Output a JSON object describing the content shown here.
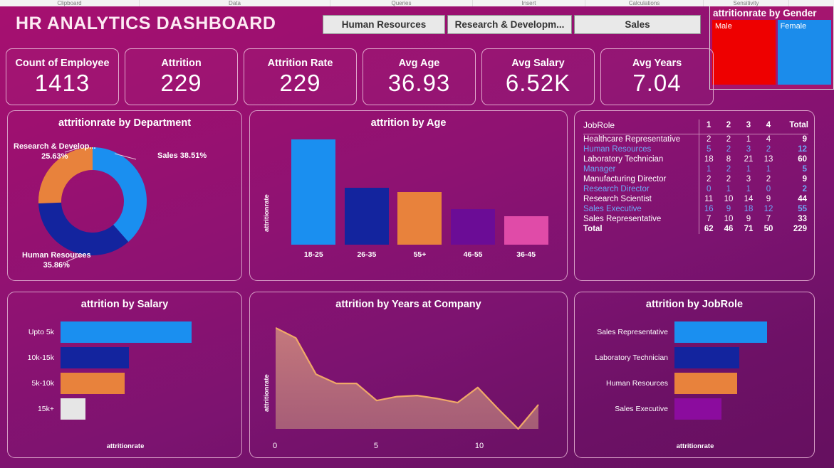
{
  "ribbon": {
    "groups": [
      "Clipboard",
      "Data",
      "Queries",
      "Insert",
      "Calculations",
      "Sensitivity"
    ]
  },
  "header": {
    "title": "HR ANALYTICS DASHBOARD",
    "slicers": [
      "Human Resources",
      "Research & Developm...",
      "Sales"
    ]
  },
  "gender_panel": {
    "title": "attritionrate by Gender",
    "cells": [
      {
        "label": "Male",
        "color": "#ee0000",
        "share": 54
      },
      {
        "label": "Female",
        "color": "#1b8ceb",
        "share": 46
      }
    ]
  },
  "kpis": [
    {
      "label": "Count of Employee",
      "value": "1413"
    },
    {
      "label": "Attrition",
      "value": "229"
    },
    {
      "label": "Attrition Rate",
      "value": "229"
    },
    {
      "label": "Avg Age",
      "value": "36.93"
    },
    {
      "label": "Avg Salary",
      "value": "6.52K"
    },
    {
      "label": "Avg Years",
      "value": "7.04"
    }
  ],
  "colors": {
    "blue": "#1a8ff0",
    "navy": "#13249e",
    "orange": "#e8823c",
    "purple": "#6b0c96",
    "pink": "#e04ba8",
    "white": "#e6e6e6",
    "accent_line": "#f0a868"
  },
  "chart_data": [
    {
      "id": "dept",
      "type": "pie",
      "title": "attritionrate by Department",
      "labels": [
        "Sales",
        "Human Resources",
        "Research & Develop..."
      ],
      "values": [
        38.51,
        35.86,
        25.63
      ],
      "value_labels": [
        "Sales 38.51%",
        "Human Resources",
        "Research & Develop..."
      ],
      "pct_labels": [
        "38.51%",
        "35.86%",
        "25.63%"
      ],
      "colors": [
        "#1a8ff0",
        "#13249e",
        "#e8823c"
      ]
    },
    {
      "id": "age",
      "type": "bar",
      "title": "attrition by Age",
      "categories": [
        "18-25",
        "26-35",
        "55+",
        "46-55",
        "36-45"
      ],
      "values": [
        100,
        54,
        50,
        34,
        27
      ],
      "colors": [
        "#1a8ff0",
        "#13249e",
        "#e8823c",
        "#6b0c96",
        "#e04ba8"
      ],
      "xlabel": "",
      "ylabel": "attritionrate"
    },
    {
      "id": "jobrole_matrix",
      "type": "table",
      "title": "JobRole",
      "columns": [
        "JobRole",
        "1",
        "2",
        "3",
        "4",
        "Total"
      ],
      "rows": [
        {
          "role": "Healthcare Representative",
          "cells": [
            "2",
            "2",
            "1",
            "4"
          ],
          "total": "9"
        },
        {
          "role": "Human Resources",
          "cells": [
            "5",
            "2",
            "3",
            "2"
          ],
          "total": "12"
        },
        {
          "role": "Laboratory Technician",
          "cells": [
            "18",
            "8",
            "21",
            "13"
          ],
          "total": "60"
        },
        {
          "role": "Manager",
          "cells": [
            "1",
            "2",
            "1",
            "1"
          ],
          "total": "5"
        },
        {
          "role": "Manufacturing Director",
          "cells": [
            "2",
            "2",
            "3",
            "2"
          ],
          "total": "9"
        },
        {
          "role": "Research Director",
          "cells": [
            "0",
            "1",
            "1",
            "0"
          ],
          "total": "2"
        },
        {
          "role": "Research Scientist",
          "cells": [
            "11",
            "10",
            "14",
            "9"
          ],
          "total": "44"
        },
        {
          "role": "Sales Executive",
          "cells": [
            "16",
            "9",
            "18",
            "12"
          ],
          "total": "55"
        },
        {
          "role": "Sales Representative",
          "cells": [
            "7",
            "10",
            "9",
            "7"
          ],
          "total": "33"
        }
      ],
      "total_row": {
        "role": "Total",
        "cells": [
          "62",
          "46",
          "71",
          "50"
        ],
        "total": "229"
      }
    },
    {
      "id": "salary",
      "type": "bar",
      "orientation": "horizontal",
      "title": "attrition by Salary",
      "categories": [
        "Upto 5k",
        "10k-15k",
        "5k-10k",
        "15k+"
      ],
      "values": [
        100,
        52,
        49,
        19
      ],
      "colors": [
        "#1a8ff0",
        "#13249e",
        "#e8823c",
        "#e6e6e6"
      ],
      "xlabel": "attritionrate",
      "ylabel": ""
    },
    {
      "id": "years",
      "type": "area",
      "title": "attrition by Years at Company",
      "xlabel": "",
      "ylabel": "attritionrate",
      "x": [
        0,
        1,
        2,
        3,
        4,
        5,
        6,
        7,
        8,
        9,
        10,
        11,
        12,
        13
      ],
      "values": [
        100,
        90,
        54,
        45,
        45,
        28,
        32,
        33,
        30,
        26,
        41,
        20,
        0,
        24
      ],
      "xticks": [
        0,
        5,
        10
      ],
      "xlim": [
        0,
        13
      ],
      "ylim": [
        0,
        100
      ]
    },
    {
      "id": "jobrole_bar",
      "type": "bar",
      "orientation": "horizontal",
      "title": "attrition by JobRole",
      "categories": [
        "Sales Representative",
        "Laboratory Technician",
        "Human Resources",
        "Sales Executive"
      ],
      "values": [
        100,
        70,
        68,
        51
      ],
      "colors": [
        "#1a8ff0",
        "#13249e",
        "#e8823c",
        "#8b0c9e"
      ],
      "xlabel": "attritionrate",
      "ylabel": ""
    }
  ]
}
